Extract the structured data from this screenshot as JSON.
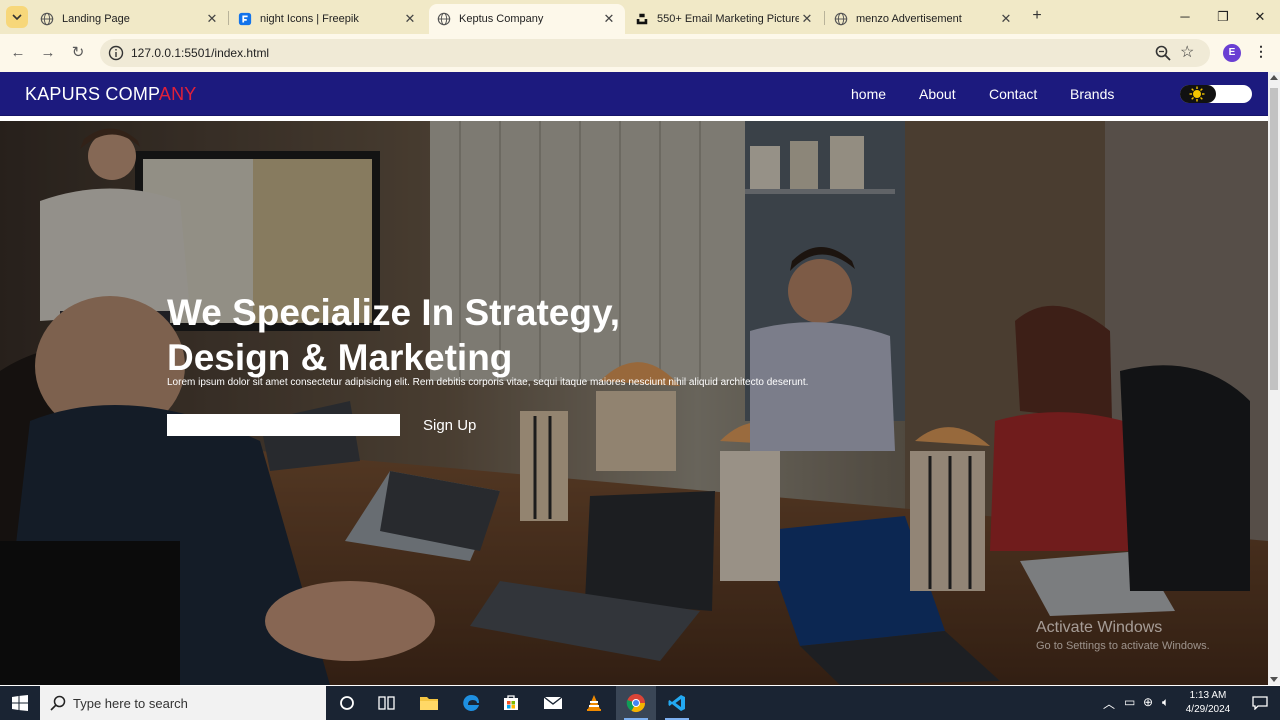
{
  "browser": {
    "tabs": [
      {
        "title": "Landing Page",
        "icon": "globe-icon"
      },
      {
        "title": "night Icons | Freepik",
        "icon": "freepik-icon"
      },
      {
        "title": "Keptus Company",
        "icon": "globe-icon",
        "active": true
      },
      {
        "title": "550+ Email Marketing Pictures",
        "icon": "unsplash-icon"
      },
      {
        "title": "menzo Advertisement",
        "icon": "globe-icon"
      }
    ],
    "url": "127.0.0.1:5501/index.html",
    "profile_initial": "E"
  },
  "site": {
    "logo_main": "KAPURS COMP",
    "logo_accent": "ANY",
    "nav": [
      {
        "label": "home"
      },
      {
        "label": "About"
      },
      {
        "label": "Contact"
      },
      {
        "label": "Brands"
      }
    ],
    "hero": {
      "title_line1": "We Specialize In Strategy,",
      "title_line2": "Design & Marketing",
      "text": "Lorem ipsum dolor sit amet consectetur adipisicing elit. Rem debitis corporis vitae, sequi itaque maiores nesciunt nihil aliquid architecto deserunt.",
      "email_value": "",
      "signup_label": "Sign Up"
    },
    "colors": {
      "nav_bg": "#1c1a7e",
      "logo_accent": "#e0203a"
    }
  },
  "watermark": {
    "title": "Activate Windows",
    "subtitle": "Go to Settings to activate Windows."
  },
  "taskbar": {
    "search_placeholder": "Type here to search",
    "time": "1:13 AM",
    "date": "4/29/2024"
  }
}
